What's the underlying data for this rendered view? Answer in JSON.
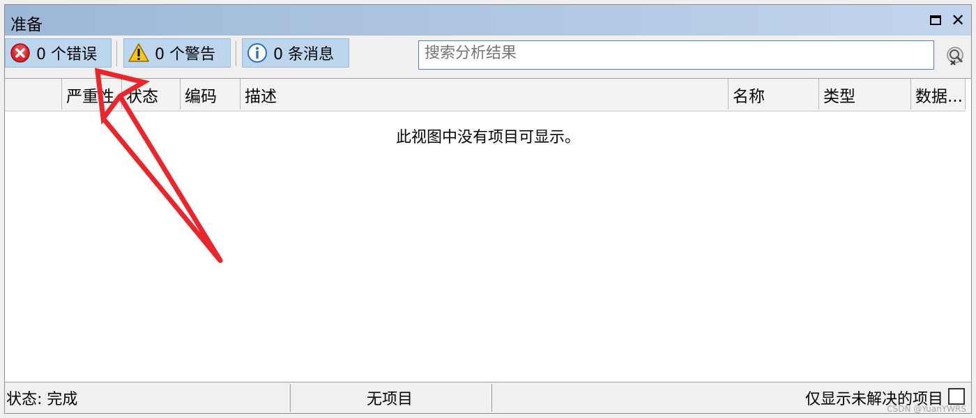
{
  "window": {
    "title": "准备"
  },
  "toolbar": {
    "errors_label": "0 个错误",
    "warnings_label": "0 个警告",
    "messages_label": "0 条消息",
    "search_placeholder": "搜索分析结果"
  },
  "columns": [
    "严重性",
    "状态",
    "编码",
    "描述",
    "名称",
    "类型",
    "数据..."
  ],
  "list": {
    "empty_message": "此视图中没有项目可显示。"
  },
  "status": {
    "state": "状态: 完成",
    "count": "无项目",
    "filter_label": "仅显示未解决的项目"
  },
  "watermark": "CSDN @YuanYWRS",
  "colors": {
    "titlebar_start": "#9db8d8",
    "titlebar_end": "#c2d5ec",
    "button_bg": "#bcd6ee",
    "arrow": "#e8262b"
  },
  "icons": [
    "error-icon",
    "warning-icon",
    "info-icon",
    "search-clear-icon",
    "maximize-icon",
    "close-icon"
  ]
}
